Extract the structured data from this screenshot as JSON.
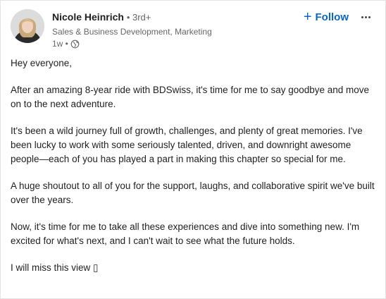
{
  "post": {
    "author": {
      "name": "Nicole Heinrich",
      "degree": "• 3rd+",
      "headline": "Sales & Business Development, Marketing",
      "time": "1w •",
      "visibility_icon": "globe-icon"
    },
    "actions": {
      "follow_plus": "+",
      "follow_label": "Follow",
      "more_icon": "ellipsis-icon"
    },
    "paragraphs": [
      "Hey everyone,",
      "After an amazing 8-year ride with BDSwiss, it's time for me to say goodbye and move on to the next adventure.",
      "It's been a wild journey full of growth, challenges, and plenty of great memories. I've been lucky to work with some seriously talented, driven, and downright awesome people—each of you has played a part in making this chapter so special for me.",
      "A huge shoutout to all of you for the support, laughs, and collaborative spirit we've built over the years.",
      "Now, it's time for me to take all these experiences and dive into something new. I'm excited for what's next, and I can't wait to see what the future holds.",
      "I will miss this view ▯"
    ],
    "colors": {
      "link_blue": "#0a66c2",
      "text_primary": "#1f1f1f",
      "text_secondary": "#666666"
    }
  }
}
